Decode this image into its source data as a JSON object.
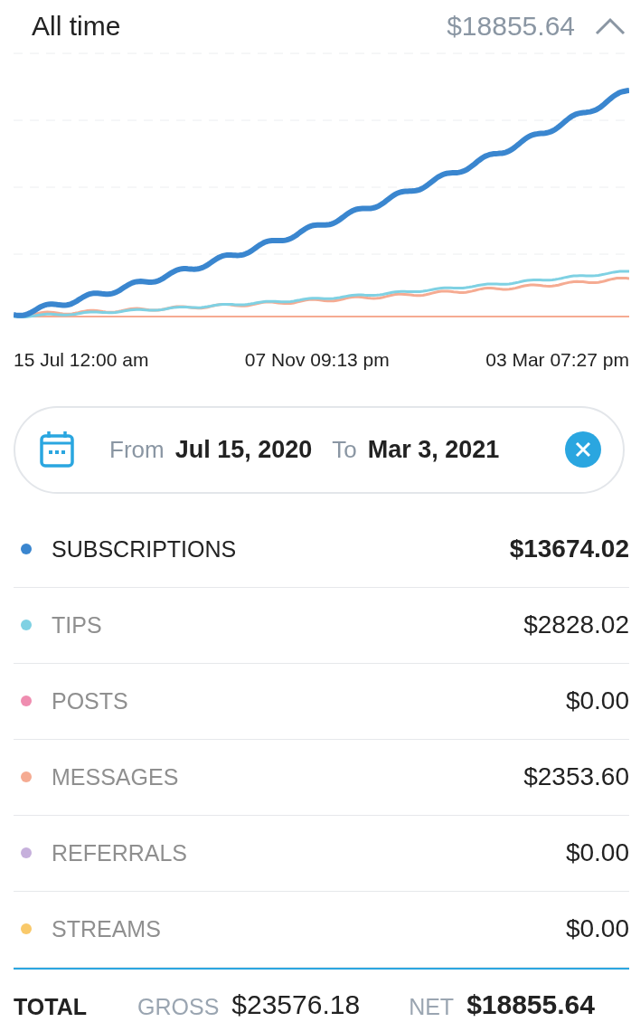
{
  "header": {
    "title": "All time",
    "amount": "$18855.64",
    "expanded": true
  },
  "chart": {
    "x_labels": [
      "15 Jul 12:00 am",
      "07 Nov 09:13 pm",
      "03 Mar 07:27 pm"
    ]
  },
  "date_range": {
    "from_label": "From",
    "from": "Jul 15, 2020",
    "to_label": "To",
    "to": "Mar 3, 2021"
  },
  "categories": [
    {
      "name": "SUBSCRIPTIONS",
      "amount": "$13674.02",
      "color": "#3a86cf",
      "selected": true
    },
    {
      "name": "TIPS",
      "amount": "$2828.02",
      "color": "#7fd1e3",
      "selected": false
    },
    {
      "name": "POSTS",
      "amount": "$0.00",
      "color": "#ef8db0",
      "selected": false
    },
    {
      "name": "MESSAGES",
      "amount": "$2353.60",
      "color": "#f5ab92",
      "selected": false
    },
    {
      "name": "REFERRALS",
      "amount": "$0.00",
      "color": "#c6b0dc",
      "selected": false
    },
    {
      "name": "STREAMS",
      "amount": "$0.00",
      "color": "#f9c96a",
      "selected": false
    }
  ],
  "total": {
    "label": "TOTAL",
    "gross_label": "GROSS",
    "gross": "$23576.18",
    "net_label": "NET",
    "net": "$18855.64"
  }
}
